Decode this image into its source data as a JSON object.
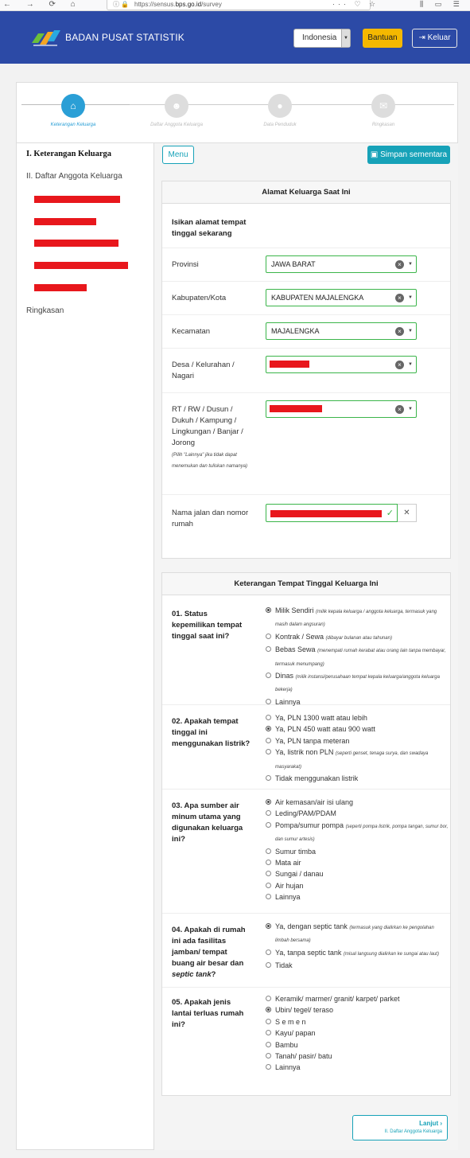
{
  "browser": {
    "url_prefix": "https://sensus.",
    "url_domain": "bps.go.id",
    "url_path": "/survey",
    "nav_glyphs": "← → ⟳ ⌂",
    "url_icons": "ⓘ 🔒",
    "url_end": "··· ♡ ☆",
    "right_icons": "⫼ ▭ ☰"
  },
  "header": {
    "brand": "BADAN PUSAT STATISTIK",
    "language": "Indonesia",
    "help_label": "Bantuan",
    "logout_label": "Keluar"
  },
  "steps": [
    {
      "label": "Keterangan Keluarga",
      "icon": "⌂",
      "active": true
    },
    {
      "label": "Daftar Anggota Keluarga",
      "icon": "☻",
      "active": false
    },
    {
      "label": "Data Penduduk",
      "icon": "●",
      "active": false
    },
    {
      "label": "Ringkasan",
      "icon": "✉",
      "active": false
    }
  ],
  "sidebar": {
    "item1": "I. Keterangan Keluarga",
    "item2": "II. Daftar Anggota Keluarga",
    "item3": "Ringkasan"
  },
  "toolbar": {
    "menu_label": "Menu",
    "save_label": "Simpan sementara"
  },
  "address": {
    "title": "Alamat Keluarga Saat Ini",
    "intro": "Isikan alamat tempat tinggal sekarang",
    "province_label": "Provinsi",
    "province_value": "JAWA BARAT",
    "regency_label": "Kabupaten/Kota",
    "regency_value": "KABUPATEN MAJALENGKA",
    "district_label": "Kecamatan",
    "district_value": "MAJALENGKA",
    "village_label": "Desa / Kelurahan / Nagari",
    "rt_label": "RT / RW / Dusun / Dukuh / Kampung / Lingkungan / Banjar / Jorong",
    "rt_hint": "(Pilih \"Lainnya\" jika tidak dapat menemukan dan tuliskan namanya)",
    "street_label": "Nama jalan dan nomor rumah"
  },
  "residence": {
    "title": "Keterangan Tempat Tinggal Keluarga Ini",
    "q1": {
      "label": "01. Status kepemilikan tempat tinggal saat ini?",
      "options": [
        {
          "text": "Milik Sendiri",
          "note": "(milik kepala keluarga / anggota keluarga, termasuk yang masih dalam angsuran)"
        },
        {
          "text": "Kontrak / Sewa",
          "note": "(dibayar bulanan atau tahunan)"
        },
        {
          "text": "Bebas Sewa",
          "note": "(menempati rumah kerabat atau orang lain tanpa membayar, termasuk menumpang)"
        },
        {
          "text": "Dinas",
          "note": "(milik instansi/perusahaan tempat kepala keluarga/anggota keluarga bekerja)"
        },
        {
          "text": "Lainnya",
          "note": ""
        }
      ]
    },
    "q2": {
      "label": "02. Apakah tempat tinggal ini menggunakan listrik?",
      "options": [
        {
          "text": "Ya, PLN 1300 watt atau lebih",
          "note": ""
        },
        {
          "text": "Ya, PLN 450 watt atau 900 watt",
          "note": ""
        },
        {
          "text": "Ya, PLN tanpa meteran",
          "note": ""
        },
        {
          "text": "Ya, listrik non PLN",
          "note": "(seperti genset, tenaga surya, dan swadaya masyarakat)"
        },
        {
          "text": "Tidak menggunakan listrik",
          "note": ""
        }
      ]
    },
    "q3": {
      "label": "03. Apa sumber air minum utama yang digunakan keluarga ini?",
      "options": [
        {
          "text": "Air kemasan/air isi ulang",
          "note": ""
        },
        {
          "text": "Leding/PAM/PDAM",
          "note": ""
        },
        {
          "text": "Pompa/sumur pompa",
          "note": "(seperti pompa listrik, pompa tangan, sumur bor, dan sumur artesis)"
        },
        {
          "text": "Sumur timba",
          "note": ""
        },
        {
          "text": "Mata air",
          "note": ""
        },
        {
          "text": "Sungai / danau",
          "note": ""
        },
        {
          "text": "Air hujan",
          "note": ""
        },
        {
          "text": "Lainnya",
          "note": ""
        }
      ]
    },
    "q4": {
      "label_a": "04. Apakah di rumah ini ada fasilitas jamban/ tempat buang air besar dan",
      "label_b": "septic tank",
      "label_c": "?",
      "options": [
        {
          "text": "Ya, dengan septic tank",
          "note": "(termasuk yang dialirkan ke pengolahan limbah bersama)"
        },
        {
          "text": "Ya, tanpa septic tank",
          "note": "(misal langsung dialirkan ke sungai atau laut)"
        },
        {
          "text": "Tidak",
          "note": ""
        }
      ]
    },
    "q5": {
      "label": "05. Apakah jenis lantai terluas rumah ini?",
      "options": [
        {
          "text": "Keramik/ marmer/ granit/ karpet/ parket",
          "note": ""
        },
        {
          "text": "Ubin/ tegel/ teraso",
          "note": ""
        },
        {
          "text": "S e m e n",
          "note": ""
        },
        {
          "text": "Kayu/ papan",
          "note": ""
        },
        {
          "text": "Bambu",
          "note": ""
        },
        {
          "text": "Tanah/ pasir/ batu",
          "note": ""
        },
        {
          "text": "Lainnya",
          "note": ""
        }
      ]
    }
  },
  "next": {
    "label": "Lanjut ›",
    "sub": "II. Daftar Anggota Keluarga"
  }
}
